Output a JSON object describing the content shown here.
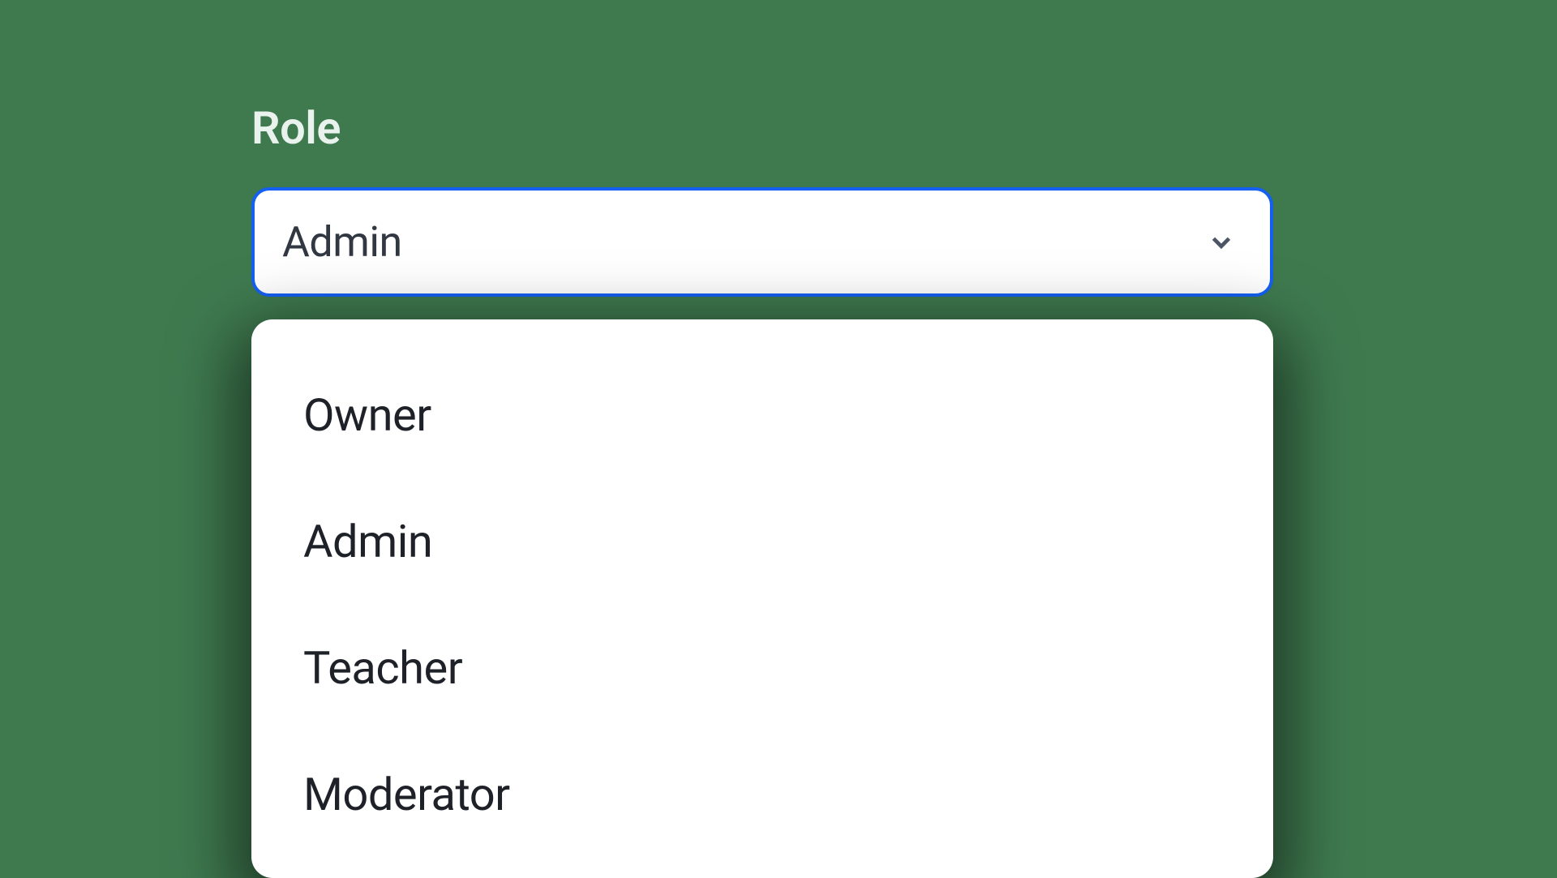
{
  "field": {
    "label": "Role",
    "selected": "Admin"
  },
  "options": [
    "Owner",
    "Admin",
    "Teacher",
    "Moderator"
  ]
}
